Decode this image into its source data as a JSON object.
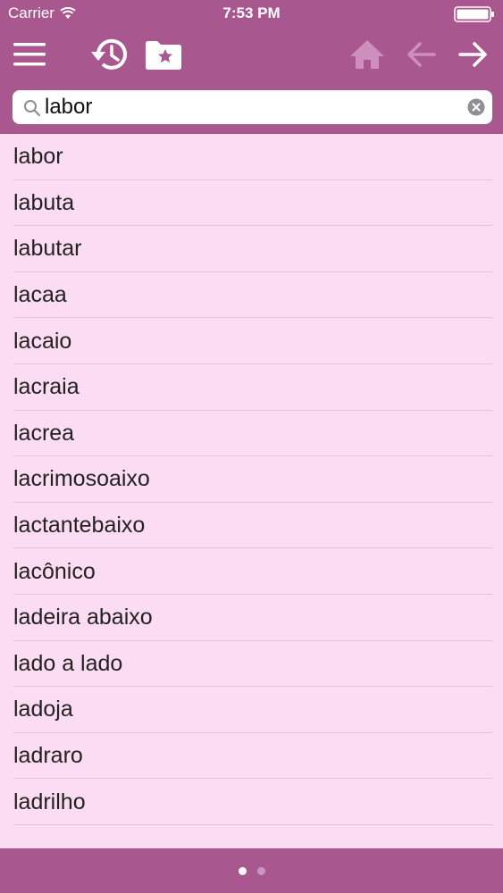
{
  "status": {
    "carrier": "Carrier",
    "time": "7:53 PM"
  },
  "toolbar": {
    "icons": [
      "menu-icon",
      "history-icon",
      "favorites-folder-icon",
      "home-icon",
      "back-arrow-icon",
      "forward-arrow-icon"
    ],
    "home_enabled": false,
    "back_enabled": false,
    "forward_enabled": true
  },
  "search": {
    "value": "labor"
  },
  "list": {
    "items": [
      {
        "label": "labor"
      },
      {
        "label": "labuta"
      },
      {
        "label": "labutar"
      },
      {
        "label": "lacaa"
      },
      {
        "label": "lacaio"
      },
      {
        "label": "lacraia"
      },
      {
        "label": "lacrea"
      },
      {
        "label": "lacrimosoaixo"
      },
      {
        "label": "lactantebaixo"
      },
      {
        "label": "lacônico"
      },
      {
        "label": "ladeira abaixo"
      },
      {
        "label": "lado a lado"
      },
      {
        "label": "ladoja"
      },
      {
        "label": "ladraro"
      },
      {
        "label": "ladrilho"
      }
    ]
  },
  "pager": {
    "pages": 2,
    "current": 1
  },
  "colors": {
    "bar": "#a8578f",
    "list_background": "#fcdcf2",
    "separator": "#e6c3db"
  }
}
